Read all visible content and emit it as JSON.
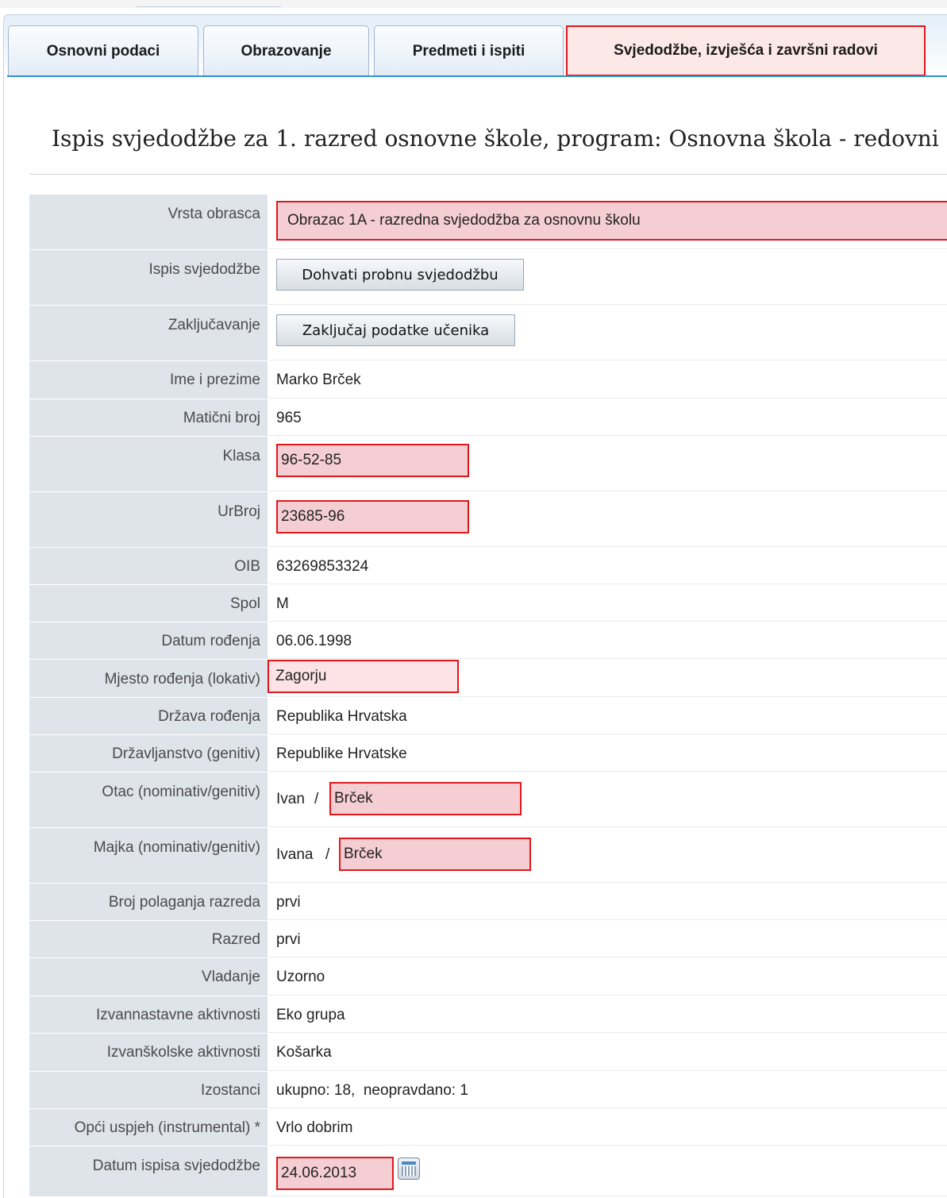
{
  "tabs": [
    {
      "label": "Osnovni podaci"
    },
    {
      "label": "Obrazovanje"
    },
    {
      "label": "Predmeti i ispiti"
    },
    {
      "label": "Svjedodžbe, izvješća i završni radovi"
    }
  ],
  "heading": "Ispis svjedodžbe za 1. razred osnovne škole, program: Osnovna škola - redovni",
  "form": {
    "vrsta_obrasca": {
      "label": "Vrsta obrasca",
      "value": "Obrazac 1A - razredna svjedodžba za osnovnu školu"
    },
    "ispis": {
      "label": "Ispis svjedodžbe",
      "button": "Dohvati probnu svjedodžbu"
    },
    "zakljucavanje": {
      "label": "Zaključavanje",
      "button": "Zaključaj podatke učenika"
    },
    "ime": {
      "label": "Ime i prezime",
      "value": "Marko Brček"
    },
    "maticni": {
      "label": "Matični broj",
      "value": "965"
    },
    "klasa": {
      "label": "Klasa",
      "value": "96-52-85"
    },
    "urbroj": {
      "label": "UrBroj",
      "value": "23685-96"
    },
    "oib": {
      "label": "OIB",
      "value": "63269853324"
    },
    "spol": {
      "label": "Spol",
      "value": "M"
    },
    "datum_rodenja": {
      "label": "Datum rođenja",
      "value": "06.06.1998"
    },
    "mjesto": {
      "label": "Mjesto rođenja (lokativ)",
      "value": "Zagorju"
    },
    "drzava": {
      "label": "Država rođenja",
      "value": "Republika Hrvatska"
    },
    "drzavljanstvo": {
      "label": "Državljanstvo (genitiv)",
      "value": "Republike Hrvatske"
    },
    "otac": {
      "label": "Otac (nominativ/genitiv)",
      "nominativ": "Ivan",
      "separator": "/",
      "genitiv": "Brček"
    },
    "majka": {
      "label": "Majka (nominativ/genitiv)",
      "nominativ": "Ivana",
      "separator": "/",
      "genitiv": "Brček"
    },
    "broj_polaganja": {
      "label": "Broj polaganja razreda",
      "value": "prvi"
    },
    "razred": {
      "label": "Razred",
      "value": "prvi"
    },
    "vladanje": {
      "label": "Vladanje",
      "value": "Uzorno"
    },
    "izvannastavne": {
      "label": "Izvannastavne aktivnosti",
      "value": "Eko grupa"
    },
    "izvanskolske": {
      "label": "Izvanškolske aktivnosti",
      "value": "Košarka"
    },
    "izostanci": {
      "label": "Izostanci",
      "value": "ukupno: 18,  neopravdano: 1"
    },
    "uspjeh": {
      "label": "Opći uspjeh (instrumental) *",
      "value": "Vrlo dobrim"
    },
    "datum_ispisa": {
      "label": "Datum ispisa svjedodžbe",
      "value": "24.06.2013"
    }
  },
  "icons": {
    "calendar": "calendar-icon"
  },
  "colors": {
    "highlight_border": "#e0181c",
    "highlight_fill": "#f5ced3",
    "label_bg": "#dfe4ea",
    "tab_accent": "#2e8fd6"
  }
}
